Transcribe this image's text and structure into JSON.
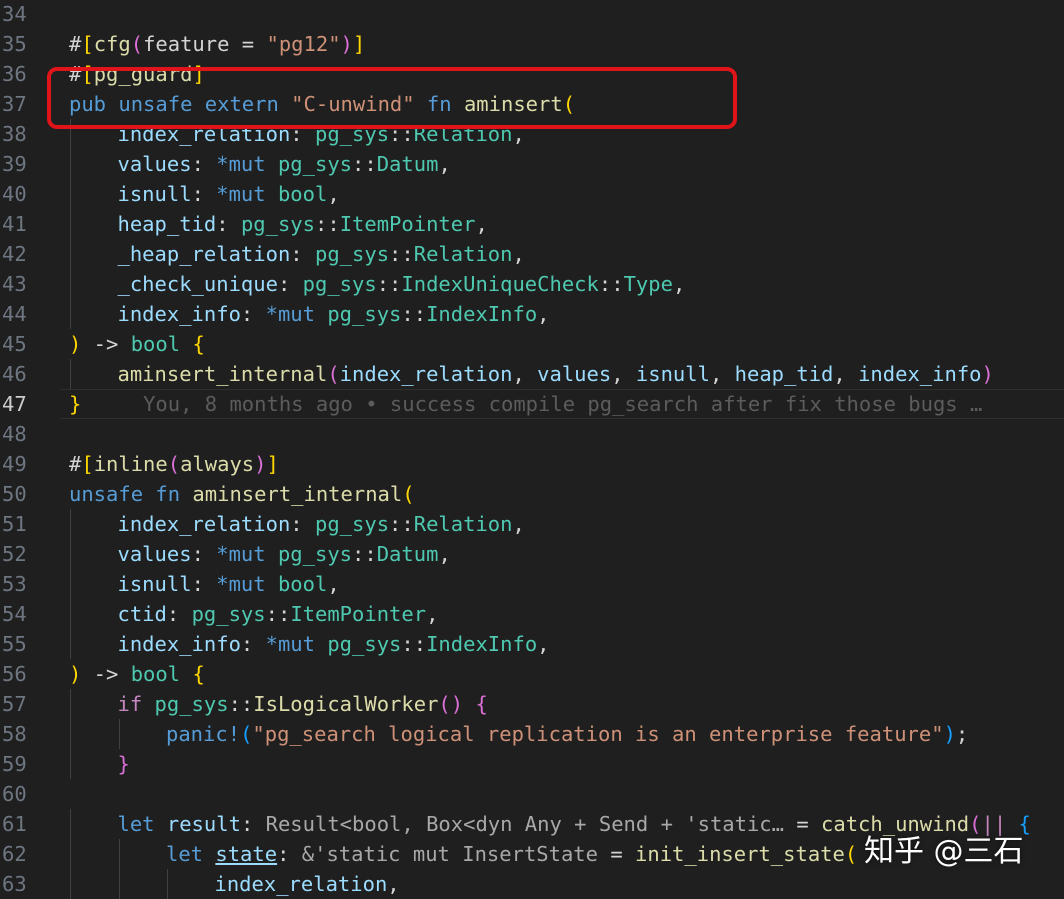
{
  "editor": {
    "language": "rust",
    "current_line": 47,
    "theme_colors": {
      "background": "#1f1f1f",
      "line_number": "#6e7681",
      "keyword": "#569cd6",
      "function": "#dcdcaa",
      "type": "#4ec9b0",
      "variable": "#9cdcfe",
      "string": "#ce9178",
      "highlight_box": "#e0141a"
    },
    "lines": [
      {
        "n": "34",
        "indent": 0,
        "tokens": []
      },
      {
        "n": "35",
        "indent": 0,
        "tokens": [
          [
            "attr",
            "#"
          ],
          [
            "br1",
            "["
          ],
          [
            "fn",
            "cfg"
          ],
          [
            "br2",
            "("
          ],
          [
            "plain",
            "feature = "
          ],
          [
            "str",
            "\"pg12\""
          ],
          [
            "br2",
            ")"
          ],
          [
            "br1",
            "]"
          ]
        ]
      },
      {
        "n": "36",
        "indent": 0,
        "tokens": [
          [
            "attr",
            "#"
          ],
          [
            "br1",
            "["
          ],
          [
            "fn",
            "pg_guard"
          ],
          [
            "br1",
            "]"
          ]
        ]
      },
      {
        "n": "37",
        "indent": 0,
        "tokens": [
          [
            "kw",
            "pub unsafe extern "
          ],
          [
            "str",
            "\"C-unwind\""
          ],
          [
            "kw",
            " fn "
          ],
          [
            "fn",
            "aminsert"
          ],
          [
            "br1",
            "("
          ]
        ]
      },
      {
        "n": "38",
        "indent": 1,
        "tokens": [
          [
            "var",
            "index_relation"
          ],
          [
            "plain",
            ": "
          ],
          [
            "type",
            "pg_sys"
          ],
          [
            "plain",
            "::"
          ],
          [
            "type",
            "Relation"
          ],
          [
            "plain",
            ","
          ]
        ]
      },
      {
        "n": "39",
        "indent": 1,
        "tokens": [
          [
            "var",
            "values"
          ],
          [
            "plain",
            ": "
          ],
          [
            "kw",
            "*mut "
          ],
          [
            "type",
            "pg_sys"
          ],
          [
            "plain",
            "::"
          ],
          [
            "type",
            "Datum"
          ],
          [
            "plain",
            ","
          ]
        ]
      },
      {
        "n": "40",
        "indent": 1,
        "tokens": [
          [
            "var",
            "isnull"
          ],
          [
            "plain",
            ": "
          ],
          [
            "kw",
            "*mut "
          ],
          [
            "type",
            "bool"
          ],
          [
            "plain",
            ","
          ]
        ]
      },
      {
        "n": "41",
        "indent": 1,
        "tokens": [
          [
            "var",
            "heap_tid"
          ],
          [
            "plain",
            ": "
          ],
          [
            "type",
            "pg_sys"
          ],
          [
            "plain",
            "::"
          ],
          [
            "type",
            "ItemPointer"
          ],
          [
            "plain",
            ","
          ]
        ]
      },
      {
        "n": "42",
        "indent": 1,
        "tokens": [
          [
            "var",
            "_heap_relation"
          ],
          [
            "plain",
            ": "
          ],
          [
            "type",
            "pg_sys"
          ],
          [
            "plain",
            "::"
          ],
          [
            "type",
            "Relation"
          ],
          [
            "plain",
            ","
          ]
        ]
      },
      {
        "n": "43",
        "indent": 1,
        "tokens": [
          [
            "var",
            "_check_unique"
          ],
          [
            "plain",
            ": "
          ],
          [
            "type",
            "pg_sys"
          ],
          [
            "plain",
            "::"
          ],
          [
            "type",
            "IndexUniqueCheck"
          ],
          [
            "plain",
            "::"
          ],
          [
            "type",
            "Type"
          ],
          [
            "plain",
            ","
          ]
        ]
      },
      {
        "n": "44",
        "indent": 1,
        "tokens": [
          [
            "var",
            "index_info"
          ],
          [
            "plain",
            ": "
          ],
          [
            "kw",
            "*mut "
          ],
          [
            "type",
            "pg_sys"
          ],
          [
            "plain",
            "::"
          ],
          [
            "type",
            "IndexInfo"
          ],
          [
            "plain",
            ","
          ]
        ]
      },
      {
        "n": "45",
        "indent": 0,
        "tokens": [
          [
            "br1",
            ")"
          ],
          [
            "plain",
            " -> "
          ],
          [
            "type",
            "bool"
          ],
          [
            "plain",
            " "
          ],
          [
            "br1",
            "{"
          ]
        ]
      },
      {
        "n": "46",
        "indent": 1,
        "tokens": [
          [
            "fn",
            "aminsert_internal"
          ],
          [
            "br2",
            "("
          ],
          [
            "var",
            "index_relation"
          ],
          [
            "plain",
            ", "
          ],
          [
            "var",
            "values"
          ],
          [
            "plain",
            ", "
          ],
          [
            "var",
            "isnull"
          ],
          [
            "plain",
            ", "
          ],
          [
            "var",
            "heap_tid"
          ],
          [
            "plain",
            ", "
          ],
          [
            "var",
            "index_info"
          ],
          [
            "br2",
            ")"
          ]
        ]
      },
      {
        "n": "47",
        "indent": 0,
        "tokens": [
          [
            "br1",
            "}"
          ],
          [
            "plain",
            "     "
          ],
          [
            "blame",
            "You, 8 months ago • success compile pg_search after fix those bugs …"
          ]
        ]
      },
      {
        "n": "48",
        "indent": 0,
        "tokens": []
      },
      {
        "n": "49",
        "indent": 0,
        "tokens": [
          [
            "attr",
            "#"
          ],
          [
            "br1",
            "["
          ],
          [
            "fn",
            "inline"
          ],
          [
            "br2",
            "("
          ],
          [
            "fn",
            "always"
          ],
          [
            "br2",
            ")"
          ],
          [
            "br1",
            "]"
          ]
        ]
      },
      {
        "n": "50",
        "indent": 0,
        "tokens": [
          [
            "kw",
            "unsafe fn "
          ],
          [
            "fn",
            "aminsert_internal"
          ],
          [
            "br1",
            "("
          ]
        ]
      },
      {
        "n": "51",
        "indent": 1,
        "tokens": [
          [
            "var",
            "index_relation"
          ],
          [
            "plain",
            ": "
          ],
          [
            "type",
            "pg_sys"
          ],
          [
            "plain",
            "::"
          ],
          [
            "type",
            "Relation"
          ],
          [
            "plain",
            ","
          ]
        ]
      },
      {
        "n": "52",
        "indent": 1,
        "tokens": [
          [
            "var",
            "values"
          ],
          [
            "plain",
            ": "
          ],
          [
            "kw",
            "*mut "
          ],
          [
            "type",
            "pg_sys"
          ],
          [
            "plain",
            "::"
          ],
          [
            "type",
            "Datum"
          ],
          [
            "plain",
            ","
          ]
        ]
      },
      {
        "n": "53",
        "indent": 1,
        "tokens": [
          [
            "var",
            "isnull"
          ],
          [
            "plain",
            ": "
          ],
          [
            "kw",
            "*mut "
          ],
          [
            "type",
            "bool"
          ],
          [
            "plain",
            ","
          ]
        ]
      },
      {
        "n": "54",
        "indent": 1,
        "tokens": [
          [
            "var",
            "ctid"
          ],
          [
            "plain",
            ": "
          ],
          [
            "type",
            "pg_sys"
          ],
          [
            "plain",
            "::"
          ],
          [
            "type",
            "ItemPointer"
          ],
          [
            "plain",
            ","
          ]
        ]
      },
      {
        "n": "55",
        "indent": 1,
        "tokens": [
          [
            "var",
            "index_info"
          ],
          [
            "plain",
            ": "
          ],
          [
            "kw",
            "*mut "
          ],
          [
            "type",
            "pg_sys"
          ],
          [
            "plain",
            "::"
          ],
          [
            "type",
            "IndexInfo"
          ],
          [
            "plain",
            ","
          ]
        ]
      },
      {
        "n": "56",
        "indent": 0,
        "tokens": [
          [
            "br1",
            ")"
          ],
          [
            "plain",
            " -> "
          ],
          [
            "type",
            "bool"
          ],
          [
            "plain",
            " "
          ],
          [
            "br1",
            "{"
          ]
        ]
      },
      {
        "n": "57",
        "indent": 1,
        "tokens": [
          [
            "ctrl",
            "if "
          ],
          [
            "type",
            "pg_sys"
          ],
          [
            "plain",
            "::"
          ],
          [
            "fn",
            "IsLogicalWorker"
          ],
          [
            "br2",
            "()"
          ],
          [
            "plain",
            " "
          ],
          [
            "br2",
            "{"
          ]
        ]
      },
      {
        "n": "58",
        "indent": 2,
        "tokens": [
          [
            "kw",
            "panic!"
          ],
          [
            "br3",
            "("
          ],
          [
            "str",
            "\"pg_search logical replication is an enterprise feature\""
          ],
          [
            "br3",
            ")"
          ],
          [
            "plain",
            ";"
          ]
        ]
      },
      {
        "n": "59",
        "indent": 1,
        "tokens": [
          [
            "br2",
            "}"
          ]
        ]
      },
      {
        "n": "60",
        "indent": 0,
        "tokens": []
      },
      {
        "n": "61",
        "indent": 1,
        "tokens": [
          [
            "kw",
            "let "
          ],
          [
            "var",
            "result"
          ],
          [
            "plain",
            ": "
          ],
          [
            "hint",
            "Result<bool, Box<dyn Any + Send + 'static… "
          ],
          [
            "plain",
            "= "
          ],
          [
            "fn",
            "catch_unwind"
          ],
          [
            "br2",
            "("
          ],
          [
            "ctrl",
            "|| "
          ],
          [
            "br3",
            "{"
          ]
        ]
      },
      {
        "n": "62",
        "indent": 2,
        "tokens": [
          [
            "kw",
            "let "
          ],
          [
            "underline",
            "state"
          ],
          [
            "plain",
            ": "
          ],
          [
            "hint",
            "&'static mut InsertState "
          ],
          [
            "plain",
            "= "
          ],
          [
            "fn",
            "init_insert_state"
          ],
          [
            "br1",
            "("
          ]
        ]
      },
      {
        "n": "63",
        "indent": 3,
        "tokens": [
          [
            "var",
            "index_relation"
          ],
          [
            "plain",
            ","
          ]
        ]
      }
    ]
  },
  "watermark": {
    "text": "知乎 @三石"
  }
}
